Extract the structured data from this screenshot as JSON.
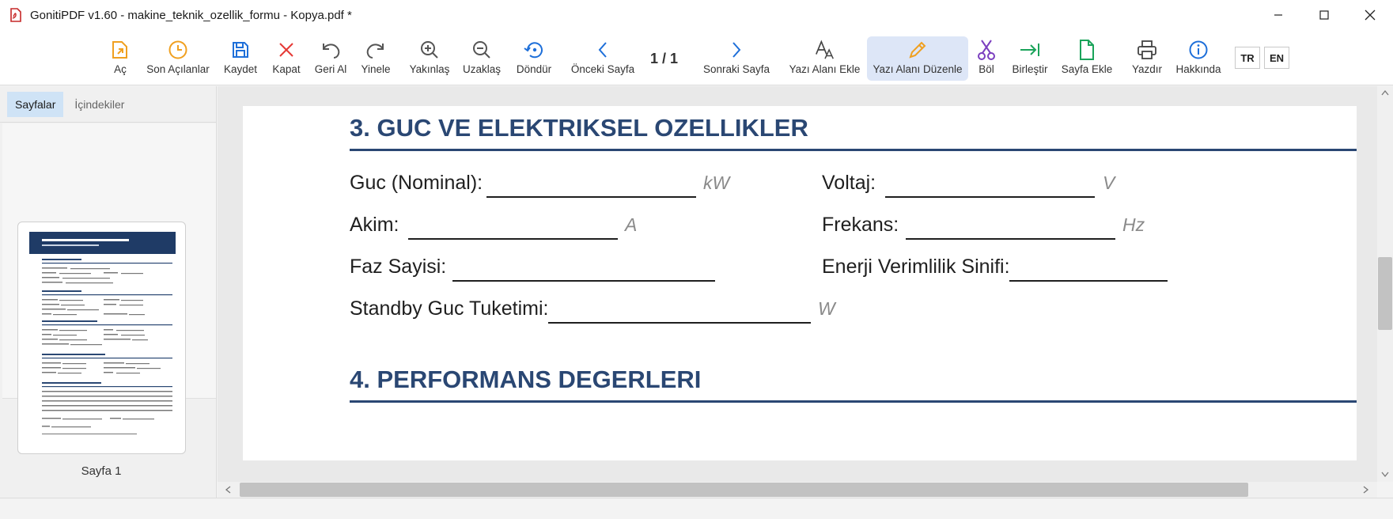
{
  "window": {
    "title": "GonitiPDF v1.60 - makine_teknik_ozellik_formu - Kopya.pdf *"
  },
  "toolbar": {
    "open": "Aç",
    "recent": "Son Açılanlar",
    "save": "Kaydet",
    "close": "Kapat",
    "undo": "Geri Al",
    "redo": "Yinele",
    "zoom_in": "Yakınlaş",
    "zoom_out": "Uzaklaş",
    "rotate": "Döndür",
    "prev_page": "Önceki Sayfa",
    "page_indicator": "1 / 1",
    "next_page": "Sonraki Sayfa",
    "add_text": "Yazı Alanı Ekle",
    "edit_text": "Yazı Alanı Düzenle",
    "split": "Böl",
    "merge": "Birleştir",
    "add_page": "Sayfa Ekle",
    "print": "Yazdır",
    "about": "Hakkında",
    "lang_tr": "TR",
    "lang_en": "EN"
  },
  "sidebar": {
    "tab_pages": "Sayfalar",
    "tab_contents": "İçindekiler",
    "thumb_label": "Sayfa 1"
  },
  "document": {
    "section3": {
      "title": "3. GUC VE ELEKTRIKSEL OZELLIKLER",
      "fields": {
        "power": "Guc (Nominal):",
        "power_unit": "kW",
        "voltage": "Voltaj:",
        "voltage_unit": "V",
        "current": "Akim:",
        "current_unit": "A",
        "frequency": "Frekans:",
        "frequency_unit": "Hz",
        "phase": "Faz Sayisi:",
        "energy_class": "Enerji Verimlilik Sinifi:",
        "standby": "Standby Guc Tuketimi:",
        "standby_unit": "W"
      }
    },
    "section4": {
      "title": "4. PERFORMANS DEGERLERI"
    }
  },
  "colors": {
    "heading_blue": "#2a4773",
    "accent_blue": "#1e6fd9",
    "active_tab_bg": "#cfe3f6",
    "active_tool_bg": "#dde6f7"
  }
}
